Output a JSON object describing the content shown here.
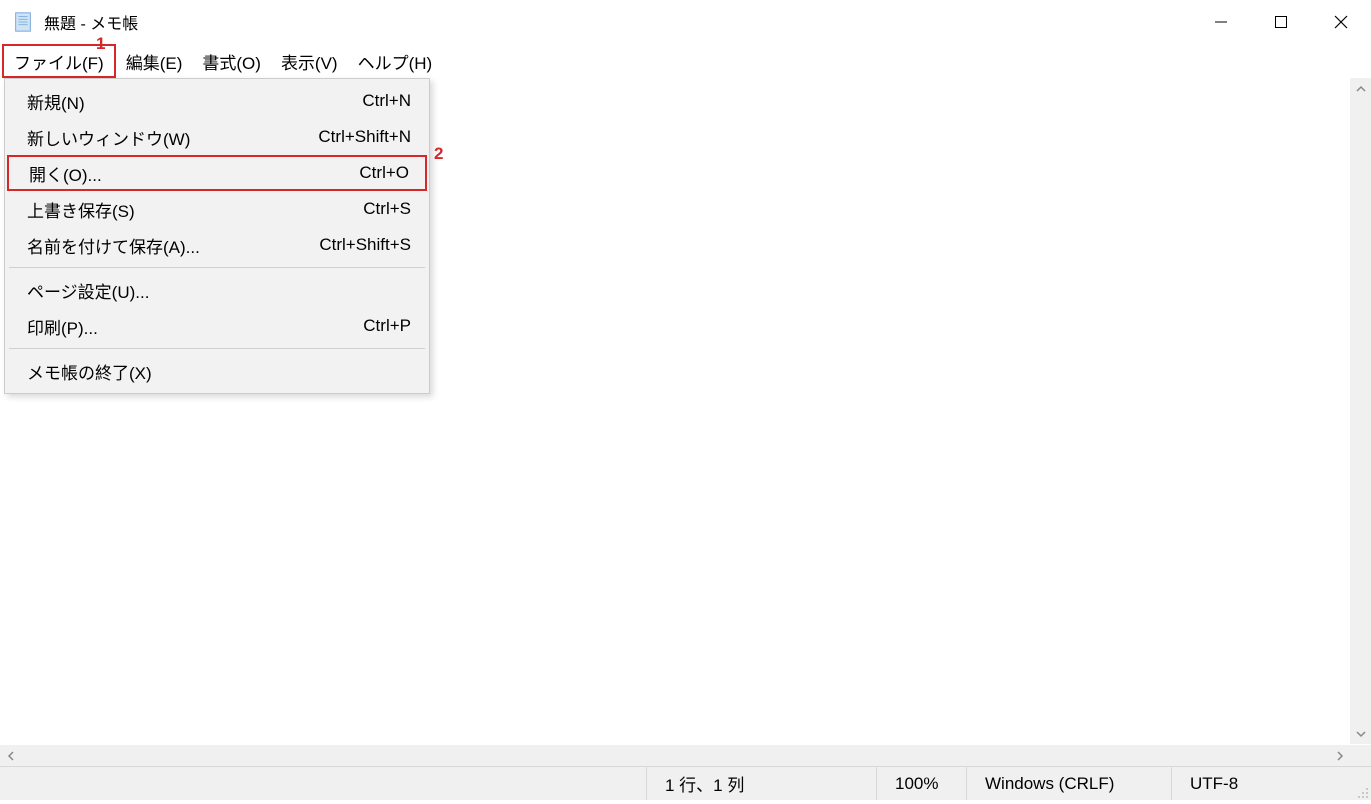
{
  "window": {
    "title": "無題 - メモ帳"
  },
  "menubar": {
    "items": [
      {
        "label": "ファイル(F)",
        "highlighted": true
      },
      {
        "label": "編集(E)"
      },
      {
        "label": "書式(O)"
      },
      {
        "label": "表示(V)"
      },
      {
        "label": "ヘルプ(H)"
      }
    ]
  },
  "dropdown": {
    "items": [
      {
        "label": "新規(N)",
        "shortcut": "Ctrl+N"
      },
      {
        "label": "新しいウィンドウ(W)",
        "shortcut": "Ctrl+Shift+N"
      },
      {
        "label": "開く(O)...",
        "shortcut": "Ctrl+O",
        "highlighted": true
      },
      {
        "label": "上書き保存(S)",
        "shortcut": "Ctrl+S"
      },
      {
        "label": "名前を付けて保存(A)...",
        "shortcut": "Ctrl+Shift+S"
      },
      {
        "label": "ページ設定(U)...",
        "shortcut": ""
      },
      {
        "label": "印刷(P)...",
        "shortcut": "Ctrl+P"
      },
      {
        "label": "メモ帳の終了(X)",
        "shortcut": ""
      }
    ]
  },
  "annotations": {
    "1": "1",
    "2": "2"
  },
  "statusbar": {
    "position": "1 行、1 列",
    "zoom": "100%",
    "line_ending": "Windows (CRLF)",
    "encoding": "UTF-8"
  }
}
